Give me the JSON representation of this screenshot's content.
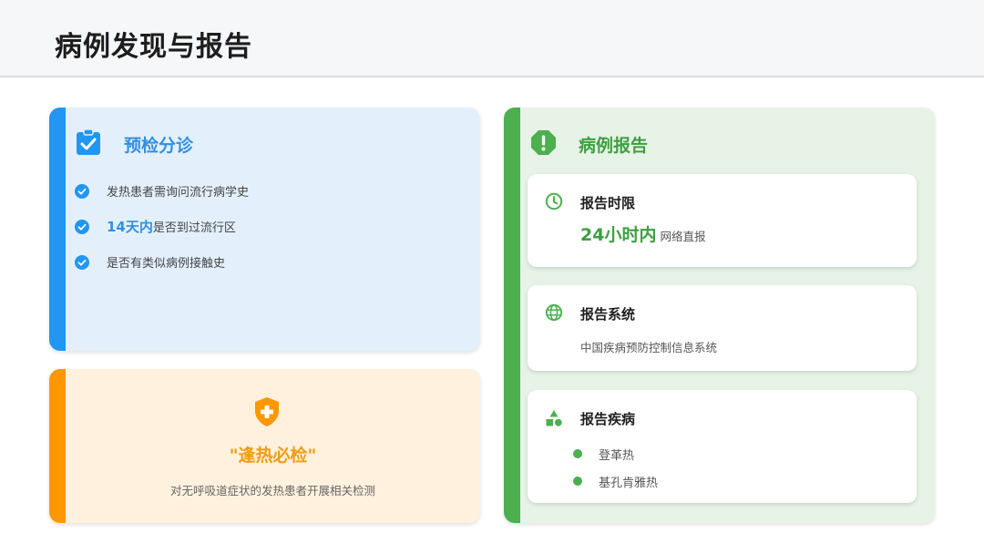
{
  "header": {
    "title": "病例发现与报告"
  },
  "colors": {
    "blue": "#2196f3",
    "orange": "#ff9800",
    "green": "#4caf50"
  },
  "triage": {
    "icon": "clipboard-check-icon",
    "title": "预检分诊",
    "items": [
      {
        "text": "发热患者需询问流行病学史"
      },
      {
        "highlight": "14天内",
        "text": "是否到过流行区"
      },
      {
        "text": "是否有类似病例接触史"
      }
    ]
  },
  "must_test": {
    "icon": "shield-plus-icon",
    "title": "\"逢热必检\"",
    "description": "对无呼吸道症状的发热患者开展相关检测"
  },
  "report": {
    "icon": "alert-octagon-icon",
    "title": "病例报告",
    "time_limit": {
      "icon": "clock-icon",
      "title": "报告时限",
      "value": "24小时内",
      "note": "网络直报"
    },
    "system": {
      "icon": "globe-icon",
      "title": "报告系统",
      "text": "中国疾病预防控制信息系统"
    },
    "diseases": {
      "icon": "shapes-icon",
      "title": "报告疾病",
      "items": [
        "登革热",
        "基孔肯雅热"
      ]
    }
  }
}
